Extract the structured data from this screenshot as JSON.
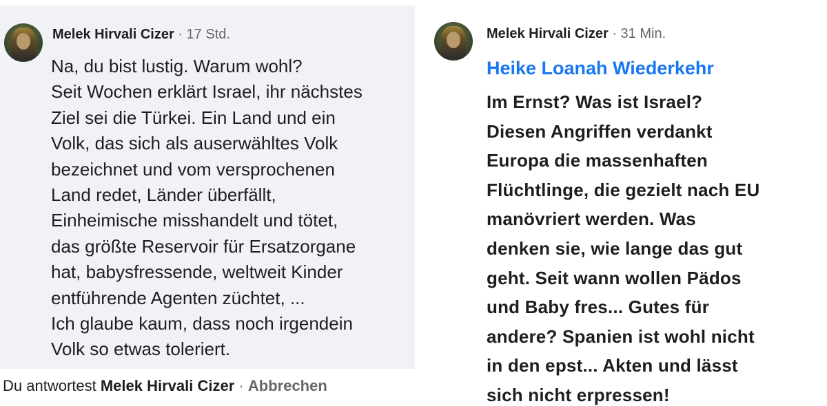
{
  "left": {
    "author": "Melek Hirvali Cizer",
    "separator": "·",
    "time": "17 Std.",
    "text": "Na, du bist lustig. Warum wohl?\nSeit Wochen erklärt Israel, ihr nächstes\nZiel sei die Türkei. Ein Land und ein\nVolk, das sich als auserwähltes Volk\nbezeichnet und vom versprochenen\nLand redet, Länder überfällt,\nEinheimische misshandelt und tötet,\ndas größte Reservoir für Ersatzorgane\nhat, babysfressende, weltweit Kinder\nentführende Agenten züchtet, ...\nIch glaube kaum, dass noch irgendein\nVolk so etwas toleriert.",
    "reply": {
      "prefix": "Du antwortest",
      "name": "Melek Hirvali Cizer",
      "separator": "·",
      "cancel": "Abbrechen"
    }
  },
  "right": {
    "author": "Melek Hirvali Cizer",
    "separator": "·",
    "time": "31 Min.",
    "mention": "Heike Loanah Wiederkehr",
    "text": "Im Ernst? Was ist Israel?\nDiesen Angriffen verdankt\nEuropa die massenhaften\nFlüchtlinge, die gezielt nach EU\nmanövriert werden. Was\ndenken sie, wie lange das gut\ngeht. Seit wann wollen Pädos\nund Baby fres... Gutes für\nandere? Spanien ist wohl nicht\nin den epst... Akten und lässt\nsich nicht erpressen!"
  }
}
